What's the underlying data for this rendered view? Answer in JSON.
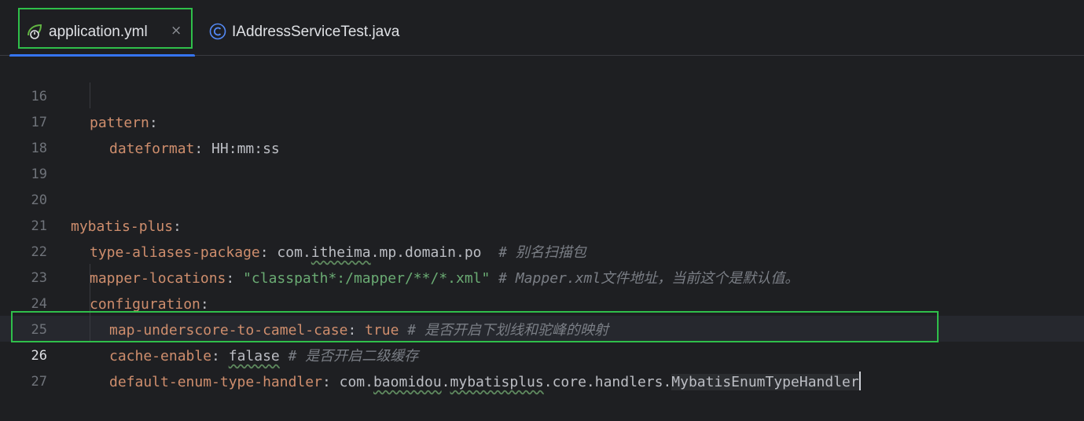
{
  "tabs": [
    {
      "label": "application.yml",
      "close": "×",
      "icon": "spring-yaml-icon",
      "active": true
    },
    {
      "label": "IAddressServiceTest.java",
      "icon": "java-class-icon",
      "active": false
    }
  ],
  "lines": [
    {
      "num": "16",
      "key": "pattern",
      "colon": ":"
    },
    {
      "num": "17",
      "key": "dateformat",
      "colon": ":",
      "value": " HH:mm:ss"
    },
    {
      "num": "18"
    },
    {
      "num": "19"
    },
    {
      "num": "20",
      "key": "mybatis-plus",
      "colon": ":"
    },
    {
      "num": "21",
      "key": "type-aliases-package",
      "colon": ":",
      "v1": " com.",
      "v2": "itheima",
      "v3": ".mp.domain.po  ",
      "comment": "# 别名扫描包"
    },
    {
      "num": "22",
      "key": "mapper-locations",
      "colon": ":",
      "str": " \"classpath*:/mapper/**/*.xml\"",
      "comment": " # Mapper.xml文件地址，当前这个是默认值。"
    },
    {
      "num": "23",
      "key": "configuration",
      "colon": ":"
    },
    {
      "num": "24",
      "key": "map-underscore-to-camel-case",
      "colon": ":",
      "kwval": " true",
      "comment": " # 是否开启下划线和驼峰的映射"
    },
    {
      "num": "25",
      "key": "cache-enable",
      "colon": ":",
      "v1": " ",
      "v2": "falase",
      "comment": " # 是否开启二级缓存"
    },
    {
      "num": "26",
      "key": "default-enum-type-handler",
      "colon": ":",
      "v1": " com.",
      "v2": "baomidou",
      "v3": ".",
      "v4": "mybatisplus",
      "v5": ".core.handlers.",
      "v6": "MybatisEnumTypeHandler"
    },
    {
      "num": "27"
    }
  ],
  "colors": {
    "key": "#cf8e6d",
    "string": "#6aab73",
    "comment": "#7a7e85",
    "text": "#bcbec4",
    "highlight": "#2fbf4a",
    "tab_underline": "#3574f0"
  }
}
